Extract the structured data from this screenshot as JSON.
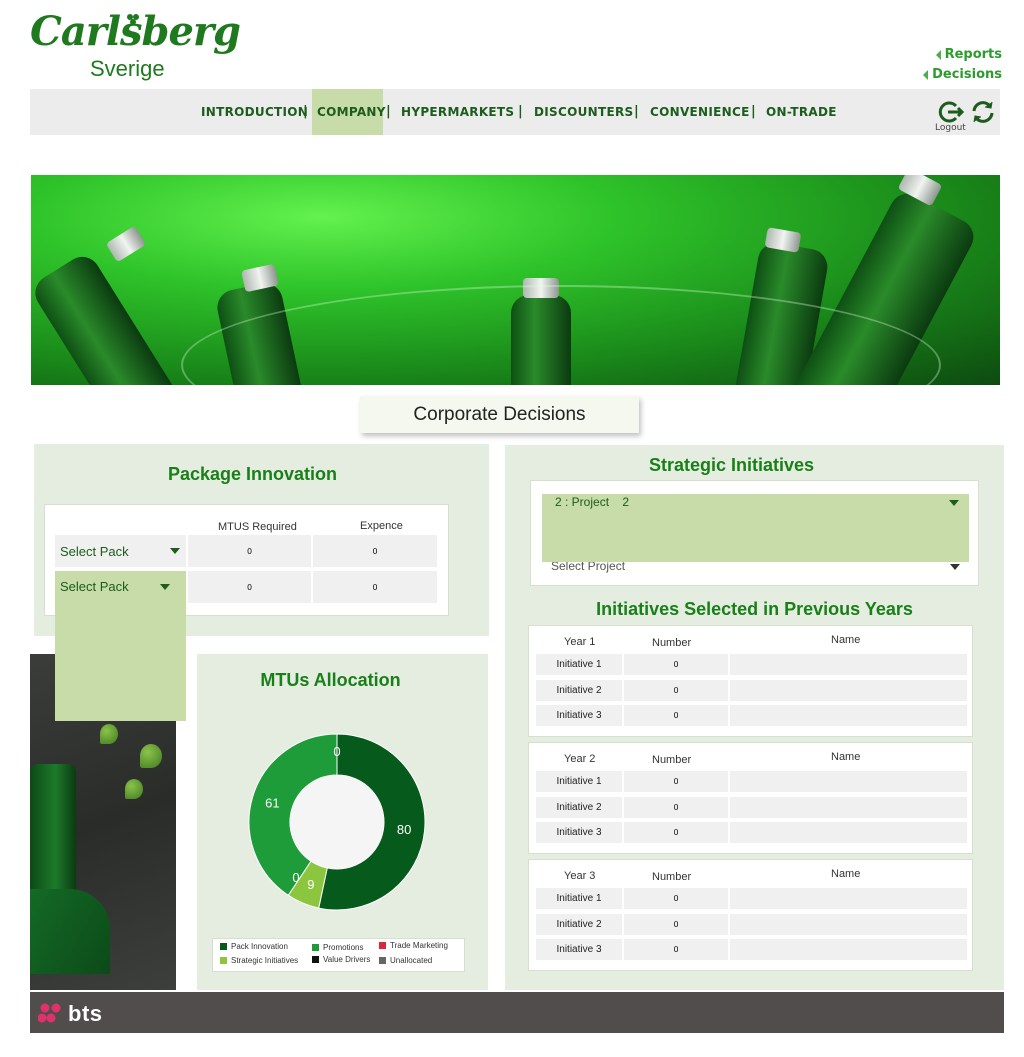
{
  "brand": {
    "name": "Carlsberg",
    "sub": "Sverige"
  },
  "top_links": {
    "reports": "Reports",
    "decisions": "Decisions"
  },
  "nav": {
    "items": [
      "INTRODUCTION",
      "COMPANY",
      "HYPERMARKETS",
      "DISCOUNTERS",
      "CONVENIENCE",
      "ON-TRADE"
    ],
    "separator": "|",
    "active": "COMPANY",
    "logout_label": "Logout"
  },
  "page_title": "Corporate Decisions",
  "package_innovation": {
    "title": "Package Innovation",
    "headers": {
      "mtus": "MTUS Required",
      "expence": "Expence"
    },
    "rows": [
      {
        "select": "Select Pack",
        "mtus": "0",
        "expence": "0"
      },
      {
        "select": "Select Pack",
        "mtus": "0",
        "expence": "0"
      }
    ]
  },
  "strategic_initiatives": {
    "title": "Strategic Initiatives",
    "selected": "2 : Project    2",
    "second_select": "Select Project"
  },
  "previous_years": {
    "title": "Initiatives Selected in Previous Years",
    "headers": {
      "number": "Number",
      "name": "Name"
    },
    "years": [
      {
        "label": "Year 1",
        "rows": [
          {
            "label": "Initiative 1",
            "number": "0"
          },
          {
            "label": "Initiative 2",
            "number": "0"
          },
          {
            "label": "Initiative 3",
            "number": "0"
          }
        ]
      },
      {
        "label": "Year 2",
        "rows": [
          {
            "label": "Initiative 1",
            "number": "0"
          },
          {
            "label": "Initiative 2",
            "number": "0"
          },
          {
            "label": "Initiative 3",
            "number": "0"
          }
        ]
      },
      {
        "label": "Year 3",
        "rows": [
          {
            "label": "Initiative 1",
            "number": "0"
          },
          {
            "label": "Initiative 2",
            "number": "0"
          },
          {
            "label": "Initiative 3",
            "number": "0"
          }
        ]
      }
    ]
  },
  "mtus_allocation": {
    "title": "MTUs Allocation",
    "chart_data": {
      "type": "pie",
      "title": "MTUs Allocation",
      "donut": true,
      "series": [
        {
          "name": "Pack Innovation",
          "value": 80,
          "color": "#055a1c"
        },
        {
          "name": "Strategic Initiatives",
          "value": 9,
          "color": "#8cc63e"
        },
        {
          "name": "Trade Marketing",
          "value": 0,
          "color": "#d8283c"
        },
        {
          "name": "Promotions",
          "value": 61,
          "color": "#1f9c3a"
        },
        {
          "name": "Value Drivers",
          "value": 0,
          "color": "#111111"
        },
        {
          "name": "Unallocated",
          "value": 0,
          "color": "#666666"
        }
      ],
      "legend_order": [
        "Pack Innovation",
        "Promotions",
        "Trade Marketing",
        "Strategic Initiatives",
        "Value Drivers",
        "Unallocated"
      ],
      "legend_position": "bottom"
    }
  },
  "footer": {
    "brand": "bts"
  }
}
